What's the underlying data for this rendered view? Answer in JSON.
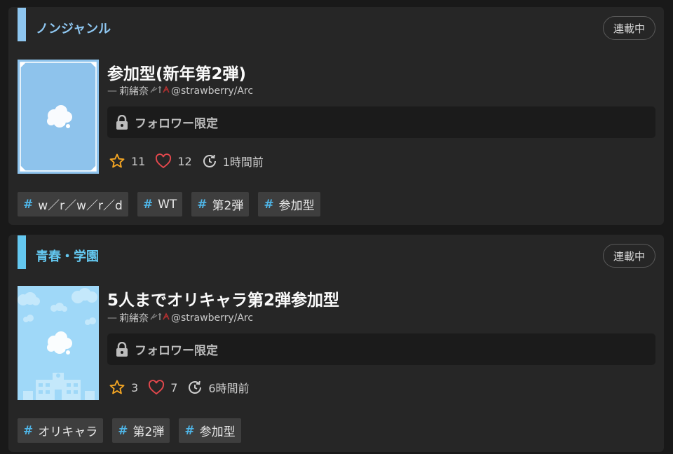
{
  "colors": {
    "accent_blue": "#4fb6e8",
    "star": "#f5a623",
    "heart": "#e5484d",
    "background": "#191919",
    "card": "#262626"
  },
  "works": [
    {
      "genre": "ノンジャンル",
      "genre_color": "#8ec6f0",
      "status": "連載中",
      "title": "参加型(新年第2弾)",
      "author_prefix": "—",
      "author_name": "莉緒奈",
      "author_handle": "@strawberry/Arc",
      "lock_icon": "lock-icon",
      "restriction": "フォロワー限定",
      "stars": "11",
      "likes": "12",
      "updated": "1時間前",
      "tags": [
        {
          "hash": "#",
          "label": "w／r／w／r／d"
        },
        {
          "hash": "#",
          "label": "WT"
        },
        {
          "hash": "#",
          "label": "第2弾"
        },
        {
          "hash": "#",
          "label": "参加型"
        }
      ]
    },
    {
      "genre": "青春・学園",
      "genre_color": "#64c8f0",
      "status": "連載中",
      "title": "5人までオリキャラ第2弾参加型",
      "author_prefix": "—",
      "author_name": "莉緒奈",
      "author_handle": "@strawberry/Arc",
      "lock_icon": "lock-icon",
      "restriction": "フォロワー限定",
      "stars": "3",
      "likes": "7",
      "updated": "6時間前",
      "tags": [
        {
          "hash": "#",
          "label": "オリキャラ"
        },
        {
          "hash": "#",
          "label": "第2弾"
        },
        {
          "hash": "#",
          "label": "参加型"
        }
      ]
    }
  ]
}
